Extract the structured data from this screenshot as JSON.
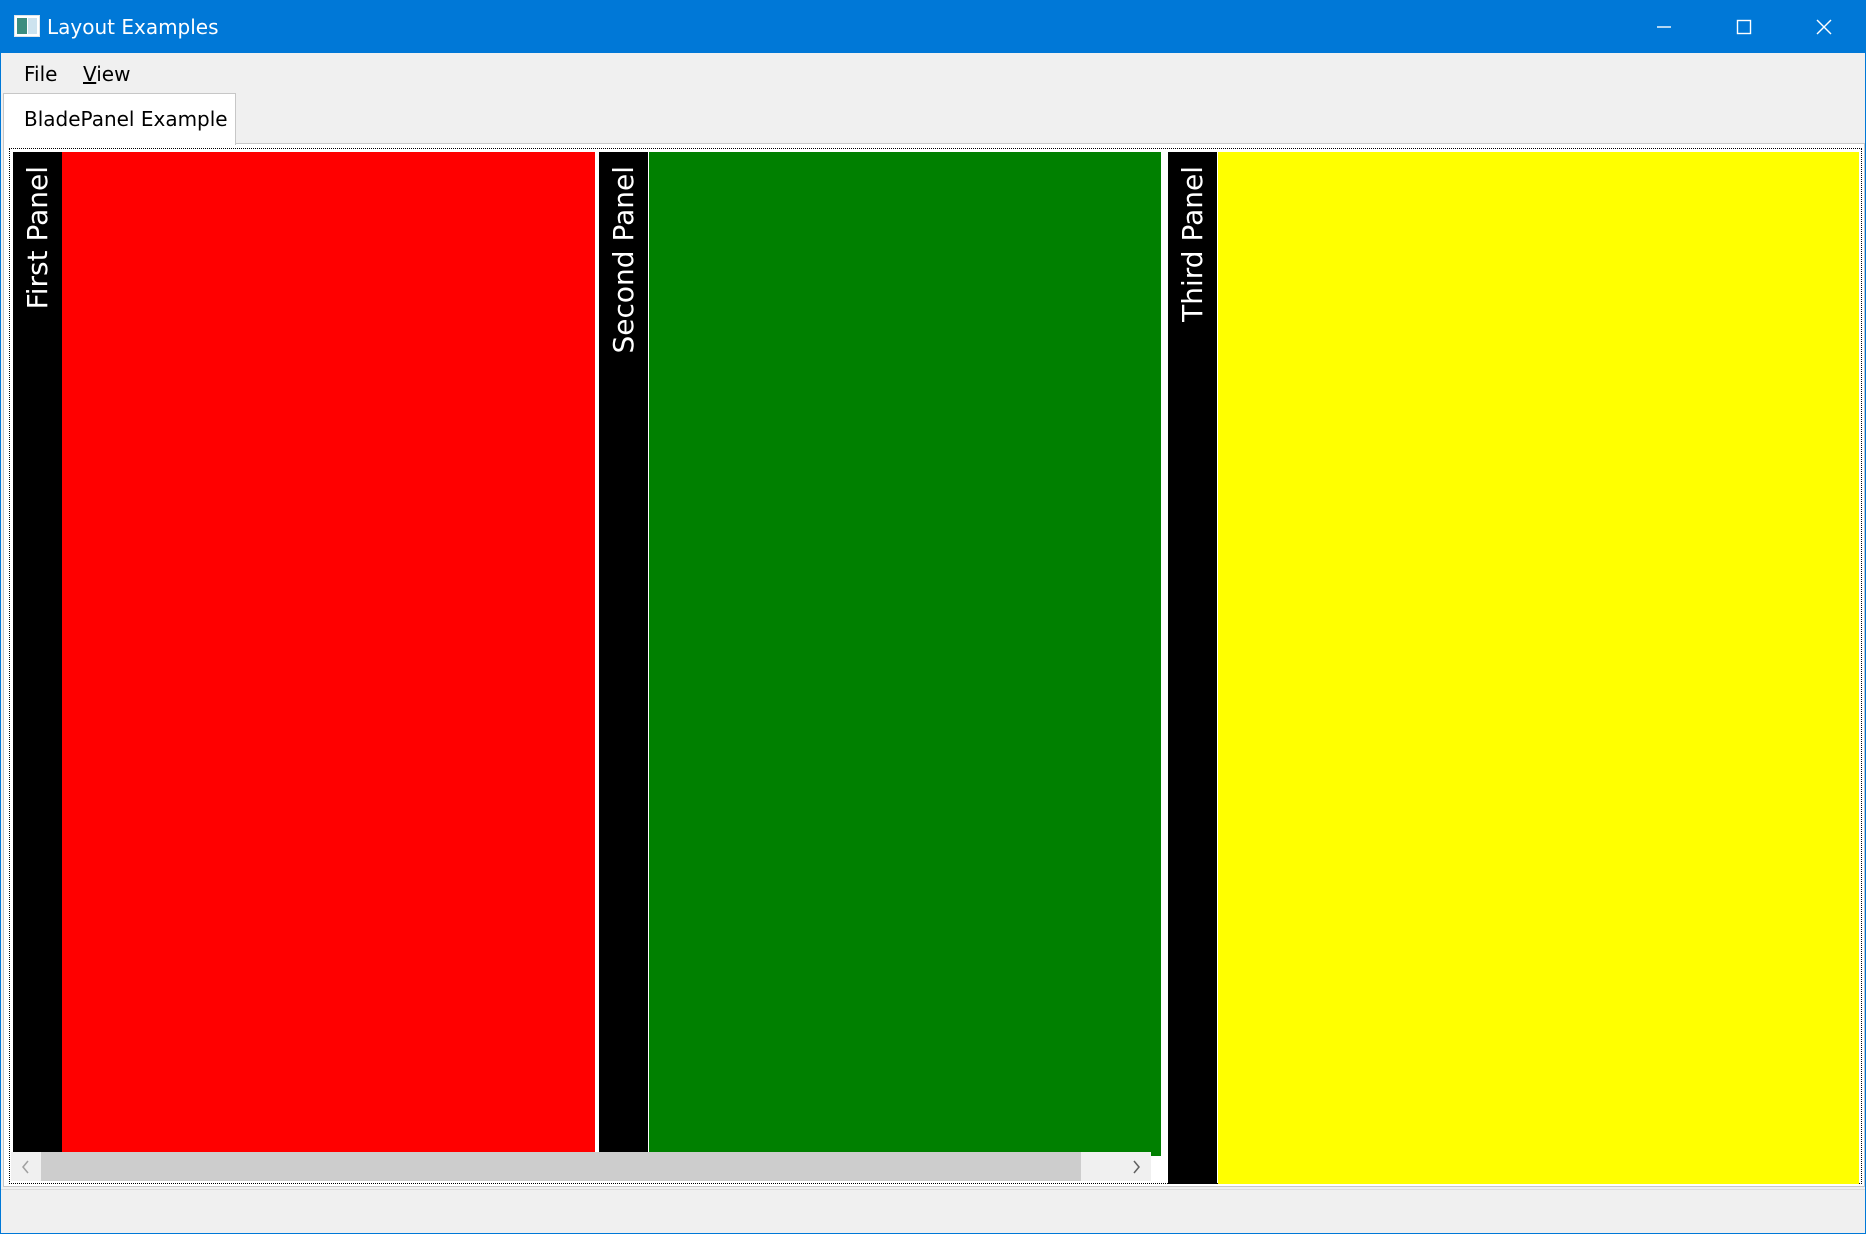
{
  "window": {
    "title": "Layout Examples",
    "icon": "app-window-icon",
    "accent_color": "#0078d7",
    "controls": {
      "minimize_icon": "minimize-icon",
      "maximize_icon": "maximize-icon",
      "close_icon": "close-icon"
    }
  },
  "menu": {
    "items": [
      {
        "label": "File"
      },
      {
        "label": "View"
      }
    ]
  },
  "tabs": [
    {
      "label": "BladePanel Example",
      "selected": true
    }
  ],
  "blades": [
    {
      "title": "First Panel",
      "header_color": "#000000",
      "body_color": "#ff0000"
    },
    {
      "title": "Second Panel",
      "header_color": "#000000",
      "body_color": "#008000"
    },
    {
      "title": "Third Panel",
      "header_color": "#000000",
      "body_color": "#ffff00"
    }
  ],
  "scrollbar": {
    "orientation": "horizontal",
    "left_icon": "chevron-left-icon",
    "right_icon": "chevron-right-icon"
  }
}
